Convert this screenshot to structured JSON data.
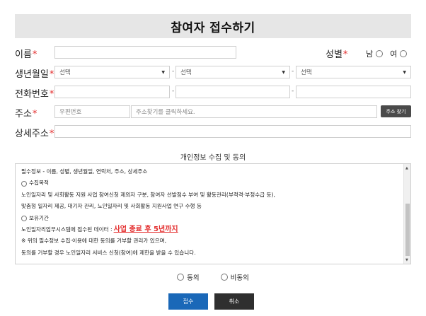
{
  "page": {
    "title": "참여자 접수하기"
  },
  "fields": {
    "name_label": "이름",
    "gender_label": "성별",
    "gender_options": [
      "남",
      "여"
    ],
    "birth_label": "생년월일",
    "birth_select": "선택",
    "phone_label": "전화번호",
    "phone_sep": "-",
    "address_label": "주소",
    "postal_placeholder": "우편번호",
    "address_placeholder": "주소찾기를 클릭하세요.",
    "address_button": "주소 찾기",
    "detail_address_label": "상세주소",
    "required_mark": "*"
  },
  "consent": {
    "title": "개인정보 수집 및 동의",
    "lines": [
      "필수정보 - 이름, 성별, 생년월일, 연락처, 주소, 상세주소",
      "수집목적",
      "노인일자리 및 사회활동 지원 사업 참여신청 제외자 구분, 참여자 선발점수 부여 및 활동관리(부적격·부정수급 등),",
      "맞춤형 일자리 제공, 대기자 관리, 노인일자리 및 사회활동 지원사업 연구 수행 등",
      "보유기간",
      "노인일자리업무시스템에 접수된 데이터 :",
      "※ 위의 필수정보 수집·이용에 대한 동의를 거부할 권리가 있으며,",
      "동의를 거부할 경우 노인일자리 서비스 신청(참여)에 제한을 받을 수 있습니다."
    ],
    "highlight": "사업 종료 후 5년까지",
    "agree": "동의",
    "disagree": "비동의"
  },
  "buttons": {
    "submit": "접수",
    "cancel": "취소"
  }
}
